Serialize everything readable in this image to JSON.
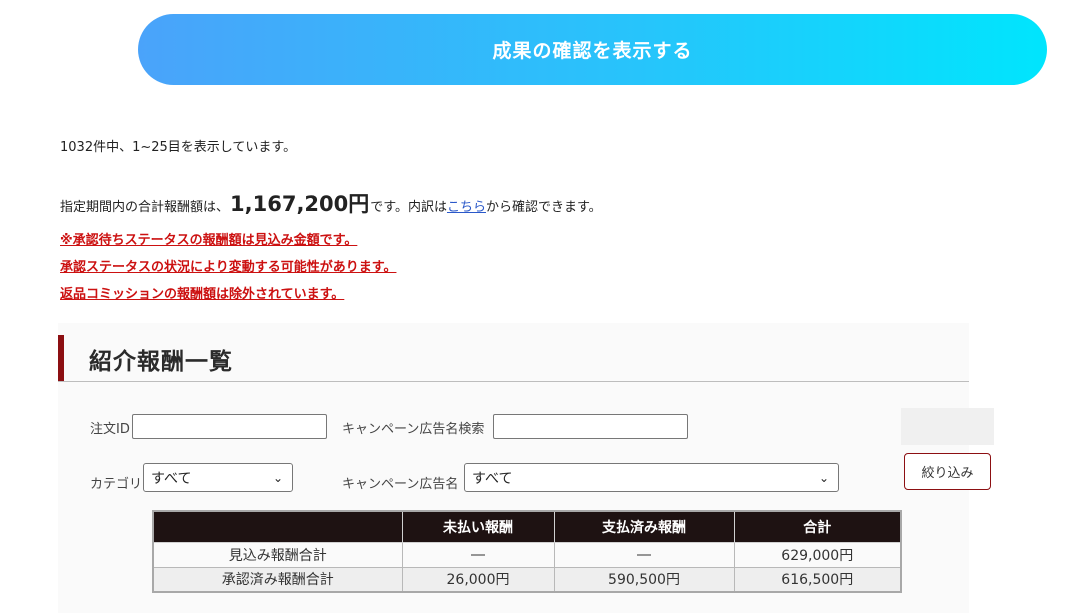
{
  "header": {
    "show_results_label": "成果の確認を表示する"
  },
  "summary": {
    "count_text": "1032件中、1~25目を表示しています。",
    "total_prefix": "指定期間内の合計報酬額は、",
    "total_amount": "1,167,200円",
    "total_middle": "です。内訳は",
    "breakdown_link": "こちら",
    "total_suffix": "から確認できます。"
  },
  "notices": [
    "※承認待ちステータスの報酬額は見込み金額です。",
    "承認ステータスの状況により変動する可能性があります。",
    "返品コミッションの報酬額は除外されています。"
  ],
  "section": {
    "title": "紹介報酬一覧"
  },
  "filters": {
    "order_id_label": "注文ID",
    "order_id_value": "",
    "campaign_search_label": "キャンペーン広告名検索",
    "campaign_search_value": "",
    "category_label": "カテゴリ",
    "category_selected": "すべて",
    "campaign_label": "キャンペーン広告名",
    "campaign_selected": "すべて",
    "filter_button": "絞り込み"
  },
  "table": {
    "headers": [
      "",
      "未払い報酬",
      "支払済み報酬",
      "合計"
    ],
    "rows": [
      [
        "見込み報酬合計",
        "―",
        "―",
        "629,000円"
      ],
      [
        "承認済み報酬合計",
        "26,000円",
        "590,500円",
        "616,500円"
      ]
    ]
  },
  "colors": {
    "button_gradient_start": "#4aa3fa",
    "button_gradient_end": "#00e5fd",
    "notice_red": "#cc1111",
    "accent_maroon": "#8c0f12",
    "table_header_bg": "#1e1212",
    "link_blue": "#2a58c9"
  }
}
